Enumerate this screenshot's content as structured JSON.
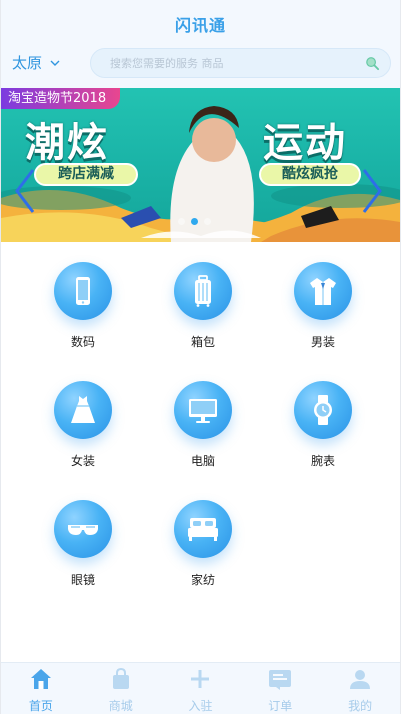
{
  "header": {
    "title": "闪讯通",
    "city": "太原",
    "search_placeholder": "搜索您需要的服务 商品"
  },
  "banner": {
    "tag": "淘宝造物节2018",
    "headline_left": "潮炫",
    "headline_right": "运动",
    "pill_left": "跨店满减",
    "pill_right": "酷炫疯抢",
    "slide_count": 3,
    "active_slide": 1
  },
  "categories": [
    {
      "label": "数码",
      "icon": "phone-icon"
    },
    {
      "label": "箱包",
      "icon": "luggage-icon"
    },
    {
      "label": "男装",
      "icon": "shirt-icon"
    },
    {
      "label": "女装",
      "icon": "dress-icon"
    },
    {
      "label": "电脑",
      "icon": "monitor-icon"
    },
    {
      "label": "腕表",
      "icon": "watch-icon"
    },
    {
      "label": "眼镜",
      "icon": "glasses-icon"
    },
    {
      "label": "家纺",
      "icon": "bed-icon"
    }
  ],
  "tabbar": {
    "items": [
      {
        "label": "首页",
        "icon": "home-icon",
        "active": true
      },
      {
        "label": "商城",
        "icon": "shopping-bag-icon",
        "active": false
      },
      {
        "label": "入驻",
        "icon": "plus-icon",
        "active": false
      },
      {
        "label": "订单",
        "icon": "order-icon",
        "active": false
      },
      {
        "label": "我的",
        "icon": "user-icon",
        "active": false
      }
    ]
  },
  "colors": {
    "accent": "#3aa0e8",
    "header_bg": "#f3f8fe",
    "tab_active": "#4aa5ea",
    "tab_inactive": "#a6cbea"
  }
}
